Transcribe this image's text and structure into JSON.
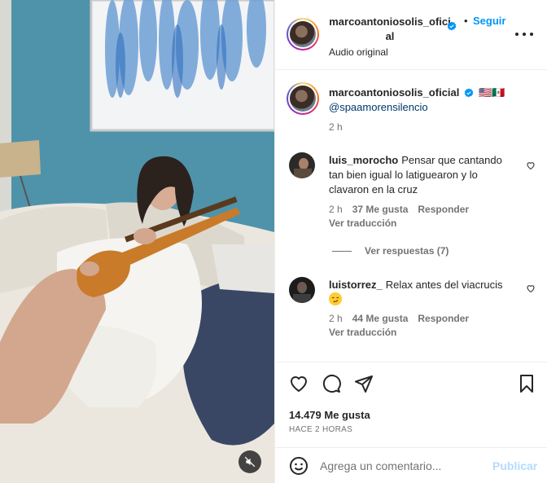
{
  "post": {
    "username": "marcoantonio­solis_oficial",
    "header_username": "marcoantonio­solis_ofi­cial",
    "follow_label": "Seguir",
    "dot": "•",
    "audio_label": "Audio original",
    "caption_text": "🇺🇸🇲🇽",
    "caption_mention": "@spaamorensilencio",
    "caption_time": "2 h",
    "likes": "14.479 Me gusta",
    "time_ago": "HACE 2 HORAS"
  },
  "comments": [
    {
      "username": "luis_morocho",
      "text": "Pensar que cantando tan bien igual lo latiguearon y lo clavaron en la cruz",
      "time": "2 h",
      "likes": "37 Me gusta",
      "reply": "Responder",
      "translate": "Ver traducción",
      "replies": "Ver respuestas (7)"
    },
    {
      "username": "luistorrez_",
      "text": "Relax antes del viacrucis",
      "time": "2 h",
      "likes": "44 Me gusta",
      "reply": "Responder",
      "translate": "Ver traducción"
    }
  ],
  "composer": {
    "placeholder": "Agrega un comentario...",
    "publish_label": "Publicar"
  },
  "colors": {
    "accent": "#0095f6",
    "link": "#00376b",
    "muted": "#737373",
    "publish_disabled": "#b3dbff",
    "wall": "#4b8ea5"
  },
  "icons": {
    "verified": "verified-badge-icon",
    "more": "more-options-icon",
    "like": "heart-icon",
    "comment": "comment-bubble-icon",
    "share": "paper-plane-icon",
    "save": "bookmark-icon",
    "emoji": "emoji-icon",
    "mute": "audio-muted-icon"
  }
}
